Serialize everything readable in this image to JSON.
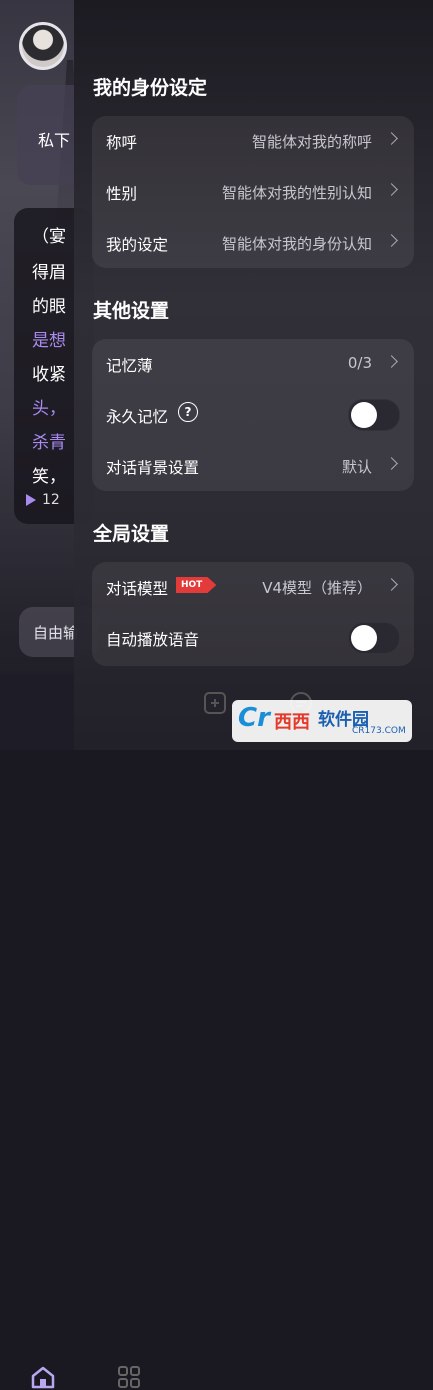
{
  "chat": {
    "bubble_snippet": "私下",
    "story_lines": [
      "（宴",
      "得眉",
      "的眼",
      "是想",
      "收紧",
      "头，",
      "杀青",
      "笑，"
    ],
    "play_count": "12",
    "input_placeholder": "自由输"
  },
  "drawer": {
    "identity": {
      "title": "我的身份设定",
      "rows": [
        {
          "label": "称呼",
          "value": "智能体对我的称呼"
        },
        {
          "label": "性别",
          "value": "智能体对我的性别认知"
        },
        {
          "label": "我的设定",
          "value": "智能体对我的身份认知"
        }
      ]
    },
    "other": {
      "title": "其他设置",
      "memo": {
        "label": "记忆薄",
        "value": "0/3"
      },
      "permanent": {
        "label": "永久记忆",
        "help": "?",
        "on": false
      },
      "background": {
        "label": "对话背景设置",
        "value": "默认"
      }
    },
    "global": {
      "title": "全局设置",
      "model": {
        "label": "对话模型",
        "badge": "HOT",
        "value": "V4模型（推荐）"
      },
      "autoplay": {
        "label": "自动播放语音",
        "on": false
      }
    }
  },
  "watermark": {
    "logo": "Cr",
    "logo2": "西西",
    "name": "软件园",
    "site": "CR173.COM"
  },
  "colors": {
    "accent_purple": "#a98bf0",
    "hot_badge": "#e33a3a"
  }
}
